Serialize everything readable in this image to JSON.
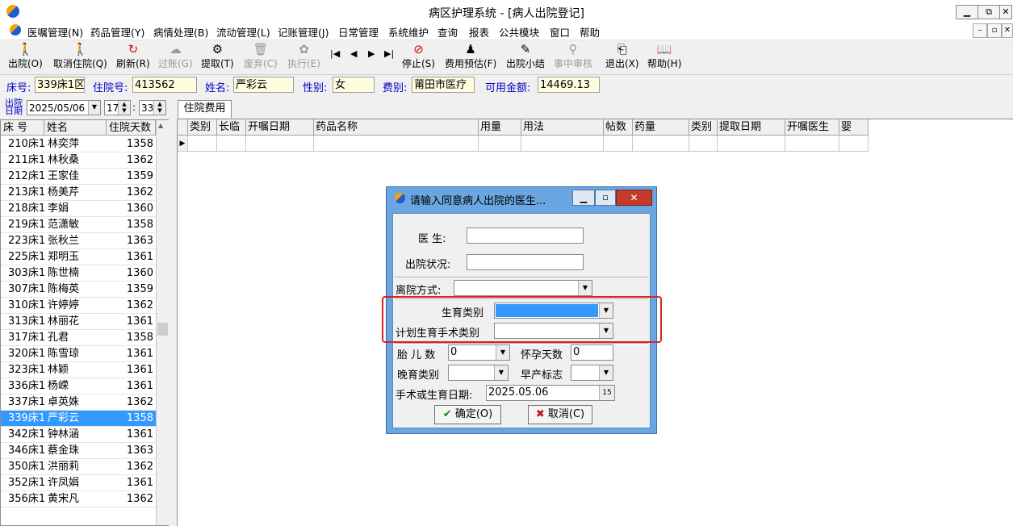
{
  "window": {
    "title": "病区护理系统 - [病人出院登记]",
    "minimize": "▁",
    "restore": "⧉",
    "close": "✕"
  },
  "menu": {
    "items": [
      "医嘱管理(N)",
      "药品管理(Y)",
      "病情处理(B)",
      "流动管理(L)",
      "记账管理(J)",
      "日常管理",
      "系统维护",
      "查询",
      "报表",
      "公共模块",
      "窗口",
      "帮助"
    ],
    "mdi_minimize": "–",
    "mdi_restore": "▫",
    "mdi_close": "✕"
  },
  "toolbar": {
    "discharge": "出院(O)",
    "cancel_admission": "取消住院(Q)",
    "refresh": "刷新(R)",
    "post": "过账(G)",
    "fetch": "提取(T)",
    "discard": "废弃(C)",
    "execute": "执行(E)",
    "nav_first": "|◀",
    "nav_prev": "◀",
    "nav_next": "▶",
    "nav_last": "▶|",
    "stop": "停止(S)",
    "fee_estimate": "费用预估(F)",
    "discharge_summary": "出院小结",
    "mid_audit": "事中审核",
    "exit": "退出(X)",
    "help": "帮助(H)"
  },
  "patient": {
    "bed_label": "床号:",
    "bed_value": "339床1区",
    "admission_label": "住院号:",
    "admission_value": "413562",
    "name_label": "姓名:",
    "name_value": "严彩云",
    "gender_label": "性别:",
    "gender_value": "女",
    "fee_label": "费别:",
    "fee_value": "莆田市医疗",
    "balance_label": "可用金额:",
    "balance_value": "14469.13"
  },
  "discharge_date": {
    "label_line1": "出院",
    "label_line2": "日期",
    "date": "2025/05/06",
    "hour": "17",
    "minute": "33",
    "colon": ":"
  },
  "patient_list": {
    "headers": [
      "床 号",
      "姓名",
      "住院天数"
    ],
    "rows": [
      {
        "bed": "210床1",
        "name": "林奕萍",
        "days": "1358"
      },
      {
        "bed": "211床1",
        "name": "林秋桑",
        "days": "1362"
      },
      {
        "bed": "212床1",
        "name": "王家佳",
        "days": "1359"
      },
      {
        "bed": "213床1",
        "name": "杨美芹",
        "days": "1362"
      },
      {
        "bed": "218床1",
        "name": "李娟",
        "days": "1360"
      },
      {
        "bed": "219床1",
        "name": "范潇敏",
        "days": "1358"
      },
      {
        "bed": "223床1",
        "name": "张秋兰",
        "days": "1363"
      },
      {
        "bed": "225床1",
        "name": "郑明玉",
        "days": "1361"
      },
      {
        "bed": "303床1",
        "name": "陈世楠",
        "days": "1360"
      },
      {
        "bed": "307床1",
        "name": "陈梅英",
        "days": "1359"
      },
      {
        "bed": "310床1",
        "name": "许婷婷",
        "days": "1362"
      },
      {
        "bed": "313床1",
        "name": "林丽花",
        "days": "1361"
      },
      {
        "bed": "317床1",
        "name": "孔君",
        "days": "1358"
      },
      {
        "bed": "320床1",
        "name": "陈雪琼",
        "days": "1361"
      },
      {
        "bed": "323床1",
        "name": "林颖",
        "days": "1361"
      },
      {
        "bed": "336床1",
        "name": "杨嵘",
        "days": "1361"
      },
      {
        "bed": "337床1",
        "name": "卓英姝",
        "days": "1362"
      },
      {
        "bed": "339床1",
        "name": "严彩云",
        "days": "1358",
        "selected": true
      },
      {
        "bed": "342床1",
        "name": "钟林涵",
        "days": "1361"
      },
      {
        "bed": "346床1",
        "name": "蔡金珠",
        "days": "1363"
      },
      {
        "bed": "350床1",
        "name": "洪丽莉",
        "days": "1362"
      },
      {
        "bed": "352床1",
        "name": "许凤娟",
        "days": "1361"
      },
      {
        "bed": "356床1",
        "name": "黄宋凡",
        "days": "1362"
      }
    ]
  },
  "fee_tab": {
    "label": "住院费用"
  },
  "fee_grid": {
    "headers": [
      "类别",
      "长临",
      "开嘱日期",
      "药品名称",
      "用量",
      "用法",
      "帖数",
      "药量",
      "类别",
      "提取日期",
      "开嘱医生",
      "婴"
    ],
    "row_marker": "▶"
  },
  "dialog": {
    "title": "请输入同意病人出院的医生...",
    "doctor_label": "医    生:",
    "status_label": "出院状况:",
    "leave_mode_label": "离院方式:",
    "birth_type_label": "生育类别",
    "family_planning_label": "计划生育手术类别",
    "fetus_label": "胎 儿 数",
    "fetus_value": "0",
    "pregnancy_days_label": "怀孕天数",
    "pregnancy_days_value": "0",
    "late_birth_label": "晚育类别",
    "premature_label": "早产标志",
    "date_label": "手术或生育日期:",
    "date_value": "2025.05.06",
    "ok": "确定(O)",
    "cancel": "取消(C)",
    "ok_icon": "✔",
    "cancel_icon": "✖"
  },
  "colors": {
    "accent": "#3399ff",
    "label_blue": "#0000c8",
    "highlight": "#e02020",
    "dialog_title": "#6aa6e0"
  }
}
